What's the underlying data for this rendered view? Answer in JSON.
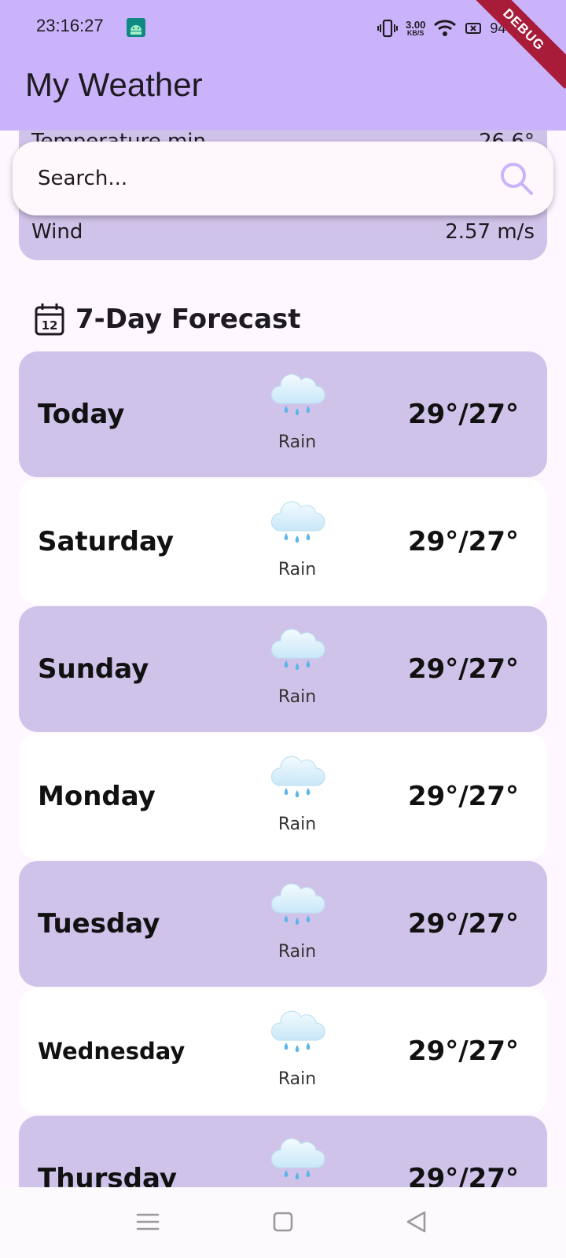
{
  "status_bar": {
    "time": "23:16:27",
    "net_speed_value": "3.00",
    "net_speed_unit": "KB/S",
    "battery": "94%"
  },
  "debug_banner": "DEBUG",
  "app_bar": {
    "title": "My Weather"
  },
  "search": {
    "placeholder": "Search..."
  },
  "current": {
    "temp_min_label": "Temperature min",
    "temp_min_value": "26.6°",
    "wind_label": "Wind",
    "wind_value": "2.57 m/s"
  },
  "forecast": {
    "title": "7-Day Forecast",
    "calendar_day": "12",
    "days": [
      {
        "day": "Today",
        "condition": "Rain",
        "temps": "29°/27°",
        "icon": "rain-cloud-icon"
      },
      {
        "day": "Saturday",
        "condition": "Rain",
        "temps": "29°/27°",
        "icon": "rain-cloud-icon"
      },
      {
        "day": "Sunday",
        "condition": "Rain",
        "temps": "29°/27°",
        "icon": "rain-cloud-icon"
      },
      {
        "day": "Monday",
        "condition": "Rain",
        "temps": "29°/27°",
        "icon": "rain-cloud-icon"
      },
      {
        "day": "Tuesday",
        "condition": "Rain",
        "temps": "29°/27°",
        "icon": "rain-cloud-icon"
      },
      {
        "day": "Wednesday",
        "condition": "Rain",
        "temps": "29°/27°",
        "icon": "rain-cloud-icon"
      },
      {
        "day": "Thursday",
        "condition": "",
        "temps": "29°/27°",
        "icon": "rain-cloud-icon"
      }
    ]
  },
  "colors": {
    "app_bar": "#cbb3fb",
    "card_shaded": "#d0c3e9",
    "background": "#fef7ff",
    "search_icon": "#cbb3fb",
    "debug_banner": "#a81c3a"
  }
}
